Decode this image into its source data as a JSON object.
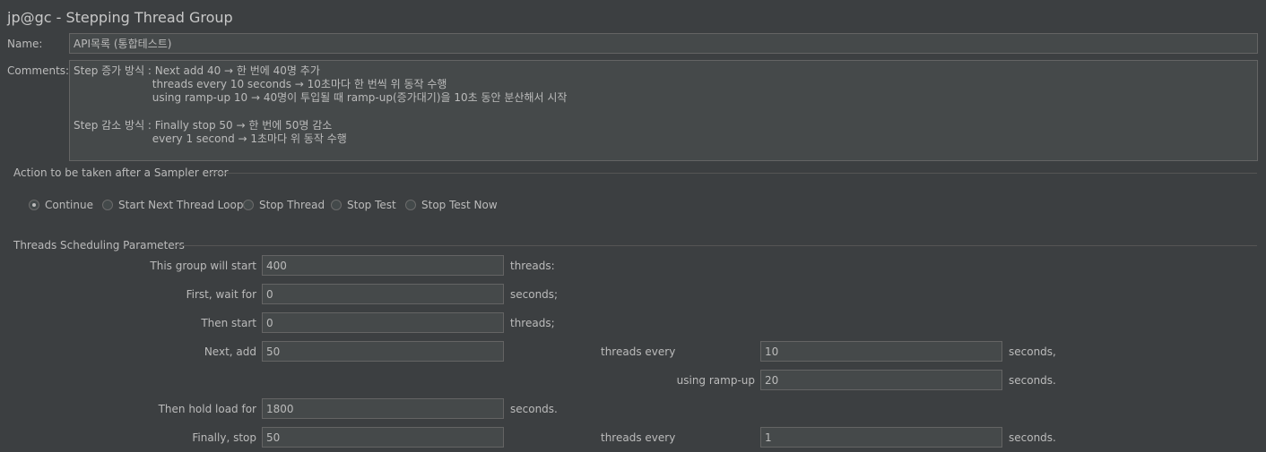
{
  "window": {
    "title": "jp@gc - Stepping Thread Group"
  },
  "name": {
    "label": "Name:",
    "value": "API목록 (통합테스트)"
  },
  "comments": {
    "label": "Comments:",
    "lines": [
      "Step 증가 방식 : Next add 40 → 한 번에 40명 추가",
      "                       threads every 10 seconds → 10초마다 한 번씩 위 동작 수행",
      "                       using ramp-up 10 → 40명이 투입될 때 ramp-up(증가대기)을 10초 동안 분산해서 시작",
      "",
      "Step 감소 방식 : Finally stop 50 → 한 번에 50명 감소",
      "                       every 1 second → 1초마다 위 동작 수행"
    ]
  },
  "error_action": {
    "title": "Action to be taken after a Sampler error",
    "options": [
      {
        "label": "Continue",
        "selected": true
      },
      {
        "label": "Start Next Thread Loop",
        "selected": false
      },
      {
        "label": "Stop Thread",
        "selected": false
      },
      {
        "label": "Stop Test",
        "selected": false
      },
      {
        "label": "Stop Test Now",
        "selected": false
      }
    ]
  },
  "scheduling": {
    "title": "Threads Scheduling Parameters",
    "group_start": {
      "label": "This group will start",
      "value": "400",
      "unit": "threads:"
    },
    "wait_for": {
      "label": "First, wait for",
      "value": "0",
      "unit": "seconds;"
    },
    "then_start": {
      "label": "Then start",
      "value": "0",
      "unit": "threads;"
    },
    "next_add": {
      "label": "Next, add",
      "value": "50",
      "mid_label": "threads every",
      "every_value": "10",
      "unit": "seconds,"
    },
    "ramp_up": {
      "label": "using ramp-up",
      "value": "20",
      "unit": "seconds."
    },
    "hold_load": {
      "label": "Then hold load for",
      "value": "1800",
      "unit": "seconds."
    },
    "finally_stop": {
      "label": "Finally, stop",
      "value": "50",
      "mid_label": "threads every",
      "every_value": "1",
      "unit": "seconds."
    }
  }
}
